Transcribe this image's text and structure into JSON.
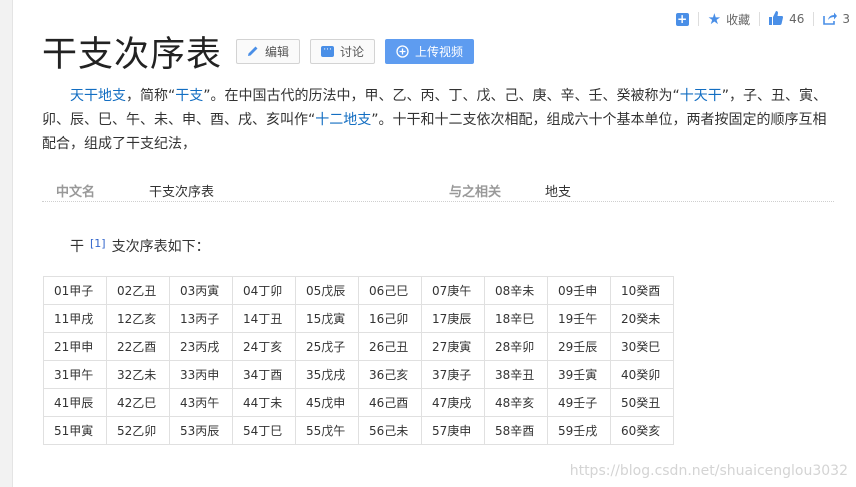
{
  "toolbar": {
    "collect_label": "收藏",
    "like_count": "46",
    "share_count": "3"
  },
  "title": "干支次序表",
  "buttons": {
    "edit": "编辑",
    "discuss": "讨论",
    "upload": "上传视频"
  },
  "summary": {
    "link1": "天干地支",
    "t1": "，简称“",
    "link2": "干支",
    "t2": "”。在中国古代的历法中，甲、乙、丙、丁、戊、己、庚、辛、壬、癸被称为“",
    "link3": "十天干",
    "t3": "”，子、丑、寅、卯、辰、巳、午、未、申、酉、戌、亥叫作“",
    "link4": "十二地支",
    "t4": "”。十干和十二支依次相配，组成六十个基本单位，两者按固定的顺序互相配合，组成了干支纪法，"
  },
  "info": {
    "name_label": "中文名",
    "name_value": "干支次序表",
    "related_label": "与之相关",
    "related_value": "地支"
  },
  "sentence": {
    "pre": "干",
    "ref": "[1]",
    "post": "支次序表如下："
  },
  "table": [
    [
      "01甲子",
      "02乙丑",
      "03丙寅",
      "04丁卯",
      "05戊辰",
      "06己巳",
      "07庚午",
      "08辛未",
      "09壬申",
      "10癸酉"
    ],
    [
      "11甲戌",
      "12乙亥",
      "13丙子",
      "14丁丑",
      "15戊寅",
      "16己卯",
      "17庚辰",
      "18辛巳",
      "19壬午",
      "20癸未"
    ],
    [
      "21甲申",
      "22乙酉",
      "23丙戌",
      "24丁亥",
      "25戊子",
      "26己丑",
      "27庚寅",
      "28辛卯",
      "29壬辰",
      "30癸巳"
    ],
    [
      "31甲午",
      "32乙未",
      "33丙申",
      "34丁酉",
      "35戊戌",
      "36己亥",
      "37庚子",
      "38辛丑",
      "39壬寅",
      "40癸卯"
    ],
    [
      "41甲辰",
      "42乙巳",
      "43丙午",
      "44丁未",
      "45戊申",
      "46己酉",
      "47庚戌",
      "48辛亥",
      "49壬子",
      "50癸丑"
    ],
    [
      "51甲寅",
      "52乙卯",
      "53丙辰",
      "54丁巳",
      "55戊午",
      "56己未",
      "57庚申",
      "58辛酉",
      "59壬戌",
      "60癸亥"
    ]
  ],
  "watermark": "https://blog.csdn.net/shuaicenglou3032",
  "colors": {
    "link": "#136ec2",
    "accent": "#4a8fe7",
    "primary_button": "#5e9cf0"
  }
}
